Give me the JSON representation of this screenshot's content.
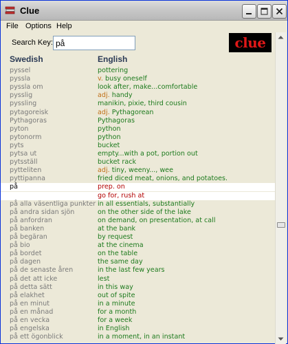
{
  "window": {
    "title": "Clue"
  },
  "menu": [
    "File",
    "Options",
    "Help"
  ],
  "search": {
    "label": "Search Key:",
    "value": "på"
  },
  "logo": "clue",
  "columns": {
    "swedish": "Swedish",
    "english": "English"
  },
  "colors": {
    "swedish_text": "#7a7a7a",
    "english_text": "#1d7a1d",
    "part_of_speech": "#c07018",
    "selected_english": "#b20000",
    "header_text": "#2b3a55",
    "logo_text": "#e01818"
  },
  "rows": [
    {
      "sv": "pyssel",
      "pos": "",
      "en": "pottering"
    },
    {
      "sv": "pyssla",
      "pos": "v.",
      "en": "busy oneself"
    },
    {
      "sv": "pyssla om",
      "pos": "",
      "en": "look after, make...comfortable"
    },
    {
      "sv": "pysslig",
      "pos": "adj.",
      "en": "handy"
    },
    {
      "sv": "pyssling",
      "pos": "",
      "en": "manikin, pixie, third cousin"
    },
    {
      "sv": "pytagoreisk",
      "pos": "adj.",
      "en": "Pythagorean"
    },
    {
      "sv": "Pythagoras",
      "pos": "",
      "en": "Pythagoras"
    },
    {
      "sv": "pyton",
      "pos": "",
      "en": "python"
    },
    {
      "sv": "pytonorm",
      "pos": "",
      "en": "python"
    },
    {
      "sv": "pyts",
      "pos": "",
      "en": "bucket"
    },
    {
      "sv": "pytsa ut",
      "pos": "",
      "en": "empty...with a pot, portion out"
    },
    {
      "sv": "pytsställ",
      "pos": "",
      "en": "bucket rack"
    },
    {
      "sv": "pytteliten",
      "pos": "adj.",
      "en": "tiny, weeny..., wee"
    },
    {
      "sv": "pyttipanna",
      "pos": "",
      "en": "fried diced meat, onions, and potatoes."
    },
    {
      "sv": "på",
      "pos": "",
      "en": "prep. on",
      "selected": true
    },
    {
      "sv": "",
      "pos": "",
      "en": "go for, rush at",
      "selected": true
    },
    {
      "sv": "på alla väsentliga punkter",
      "pos": "",
      "en": "in all essentials, substantially"
    },
    {
      "sv": "på andra sidan sjön",
      "pos": "",
      "en": "on the other side of the lake"
    },
    {
      "sv": "på anfordran",
      "pos": "",
      "en": "on demand, on presentation, at call"
    },
    {
      "sv": "på banken",
      "pos": "",
      "en": "at the bank"
    },
    {
      "sv": "på begäran",
      "pos": "",
      "en": "by request"
    },
    {
      "sv": "på bio",
      "pos": "",
      "en": "at the cinema"
    },
    {
      "sv": "på bordet",
      "pos": "",
      "en": "on the table"
    },
    {
      "sv": "på dagen",
      "pos": "",
      "en": "the same day"
    },
    {
      "sv": "på de senaste åren",
      "pos": "",
      "en": "in the last few years"
    },
    {
      "sv": "på det att icke",
      "pos": "",
      "en": "lest"
    },
    {
      "sv": "på detta sätt",
      "pos": "",
      "en": "in this way"
    },
    {
      "sv": "på elakhet",
      "pos": "",
      "en": "out of spite"
    },
    {
      "sv": "på en minut",
      "pos": "",
      "en": "in a minute"
    },
    {
      "sv": "på en månad",
      "pos": "",
      "en": "for a month"
    },
    {
      "sv": "på en vecka",
      "pos": "",
      "en": "for a week"
    },
    {
      "sv": "på engelska",
      "pos": "",
      "en": "in English"
    },
    {
      "sv": "på ett ögonblick",
      "pos": "",
      "en": "in a moment, in an instant"
    }
  ]
}
